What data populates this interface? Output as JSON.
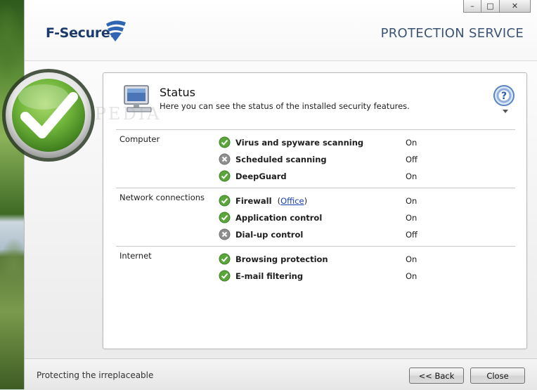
{
  "window": {
    "brand": "F-Secure.",
    "service_title": "PROTECTION SERVICE",
    "controls": {
      "minimize": "–",
      "maximize": "□",
      "close": "✕"
    }
  },
  "panel": {
    "title": "Status",
    "subtitle": "Here you can see the status of the installed security features.",
    "watermark": "SOFTPEDIA"
  },
  "sections": [
    {
      "label": "Computer",
      "features": [
        {
          "name": "Virus and spyware scanning",
          "state": "On",
          "icon": "check-icon"
        },
        {
          "name": "Scheduled scanning",
          "state": "Off",
          "icon": "cross-icon"
        },
        {
          "name": "DeepGuard",
          "state": "On",
          "icon": "check-icon"
        }
      ]
    },
    {
      "label": "Network connections",
      "features": [
        {
          "name": "Firewall",
          "link": "Office",
          "state": "On",
          "icon": "check-icon"
        },
        {
          "name": "Application control",
          "state": "On",
          "icon": "check-icon"
        },
        {
          "name": "Dial-up control",
          "state": "Off",
          "icon": "cross-icon"
        }
      ]
    },
    {
      "label": "Internet",
      "features": [
        {
          "name": "Browsing protection",
          "state": "On",
          "icon": "check-icon"
        },
        {
          "name": "E-mail filtering",
          "state": "On",
          "icon": "check-icon"
        }
      ]
    }
  ],
  "footer": {
    "tagline": "Protecting the irreplaceable",
    "back_label": "<< Back",
    "close_label": "Close"
  },
  "colors": {
    "brand": "#1b3a6b",
    "title": "#3c5475",
    "ok": "#5aa63a",
    "off": "#8f8f8f",
    "link": "#1a3fb3"
  }
}
